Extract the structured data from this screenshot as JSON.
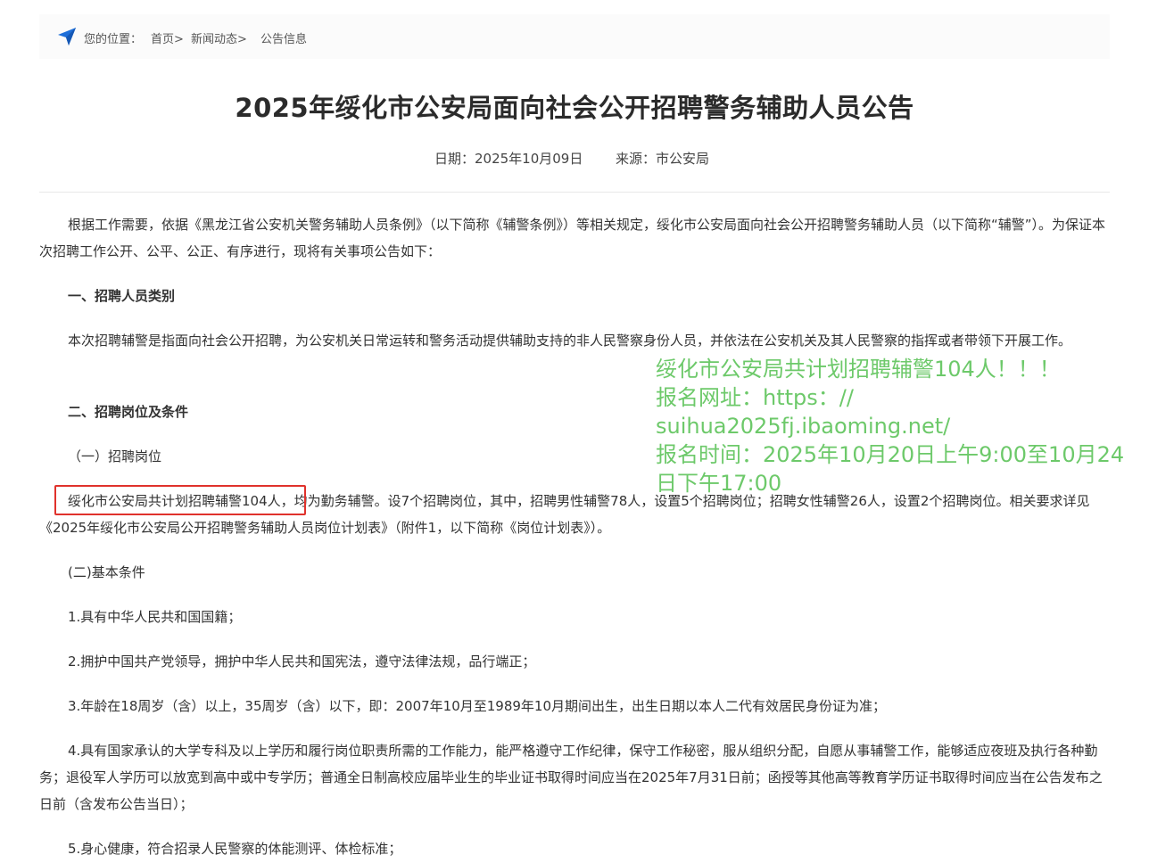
{
  "breadcrumb": {
    "location_label": "您的位置：",
    "home": "首页>",
    "news": "新闻动态>",
    "current": "公告信息"
  },
  "article": {
    "title": "2025年绥化市公安局面向社会公开招聘警务辅助人员公告",
    "date": "日期：2025年10月09日",
    "source": "来源：市公安局",
    "intro": "根据工作需要，依据《黑龙江省公安机关警务辅助人员条例》（以下简称《辅警条例》）等相关规定，绥化市公安局面向社会公开招聘警务辅助人员（以下简称“辅警”）。为保证本次招聘工作公开、公平、公正、有序进行，现将有关事项公告如下：",
    "section1_heading": "一、招聘人员类别",
    "section1_text": "本次招聘辅警是指面向社会公开招聘，为公安机关日常运转和警务活动提供辅助支持的非人民警察身份人员，并依法在公安机关及其人民警察的指挥或者带领下开展工作。",
    "section2_heading": "二、招聘岗位及条件",
    "sub1_heading": "（一）招聘岗位",
    "sub1_text": "绥化市公安局共计划招聘辅警104人，均为勤务辅警。设7个招聘岗位，其中，招聘男性辅警78人，设置5个招聘岗位；招聘女性辅警26人，设置2个招聘岗位。相关要求详见《2025年绥化市公安局公开招聘警务辅助人员岗位计划表》（附件1，以下简称《岗位计划表》）。",
    "sub2_heading": "(二)基本条件",
    "conditions": [
      "1.具有中华人民共和国国籍；",
      "2.拥护中国共产党领导，拥护中华人民共和国宪法，遵守法律法规，品行端正；",
      "3.年龄在18周岁（含）以上，35周岁（含）以下，即：2007年10月至1989年10月期间出生，出生日期以本人二代有效居民身份证为准；",
      "4.具有国家承认的大学专科及以上学历和履行岗位职责所需的工作能力，能严格遵守工作纪律，保守工作秘密，服从组织分配，自愿从事辅警工作，能够适应夜班及执行各种勤务；退役军人学历可以放宽到高中或中专学历；普通全日制高校应届毕业生的毕业证书取得时间应当在2025年7月31日前；函授等其他高等教育学历证书取得时间应当在公告发布之日前（含发布公告当日）；",
      "5.身心健康，符合招录人民警察的体能测评、体检标准；"
    ]
  },
  "overlay": {
    "line1": "绥化市公安局共计划招聘辅警104人！！！",
    "line2": "报名网址：https：//",
    "line3": "suihua2025fj.ibaoming.net/",
    "line4": "报名时间：2025年10月20日上午9:00至10月24",
    "line5": "日下午17:00"
  },
  "colors": {
    "highlight_border": "#e0322c",
    "overlay_text": "#6dc96a",
    "location_icon": "#1e6fd9"
  },
  "icons": {
    "location": "navigation-arrow-icon"
  }
}
